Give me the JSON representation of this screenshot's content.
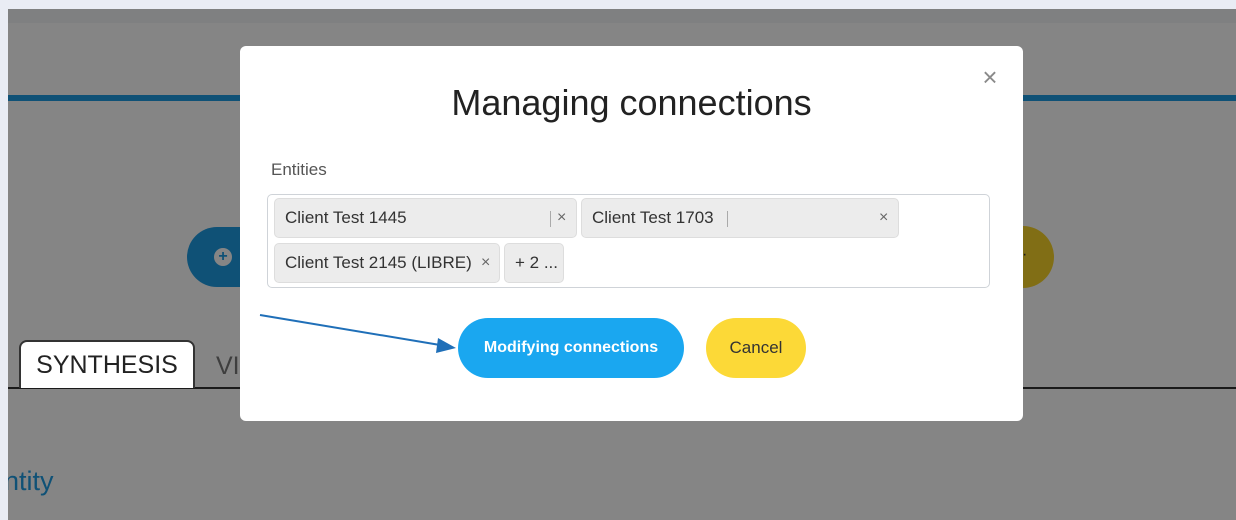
{
  "background": {
    "add_icon": "plus-circle-icon",
    "tabs": [
      {
        "label": "SYNTHESIS"
      },
      {
        "label": "VI"
      }
    ],
    "section_heading": "ntity"
  },
  "modal": {
    "title": "Managing connections",
    "close_icon": "close-icon",
    "field_label": "Entities",
    "chips": [
      {
        "label": "Client Test 1445",
        "remove": "×"
      },
      {
        "label": "Client Test 1703",
        "remove": "×"
      },
      {
        "label": "Client Test 2145 (LIBRE)",
        "remove": "×"
      }
    ],
    "more_chip": "+ 2 ...",
    "primary_button": "Modifying connections",
    "cancel_button": "Cancel"
  },
  "colors": {
    "accent_blue": "#1aa7f0",
    "accent_yellow": "#fcd937",
    "annotation_arrow": "#1f6fb8"
  }
}
